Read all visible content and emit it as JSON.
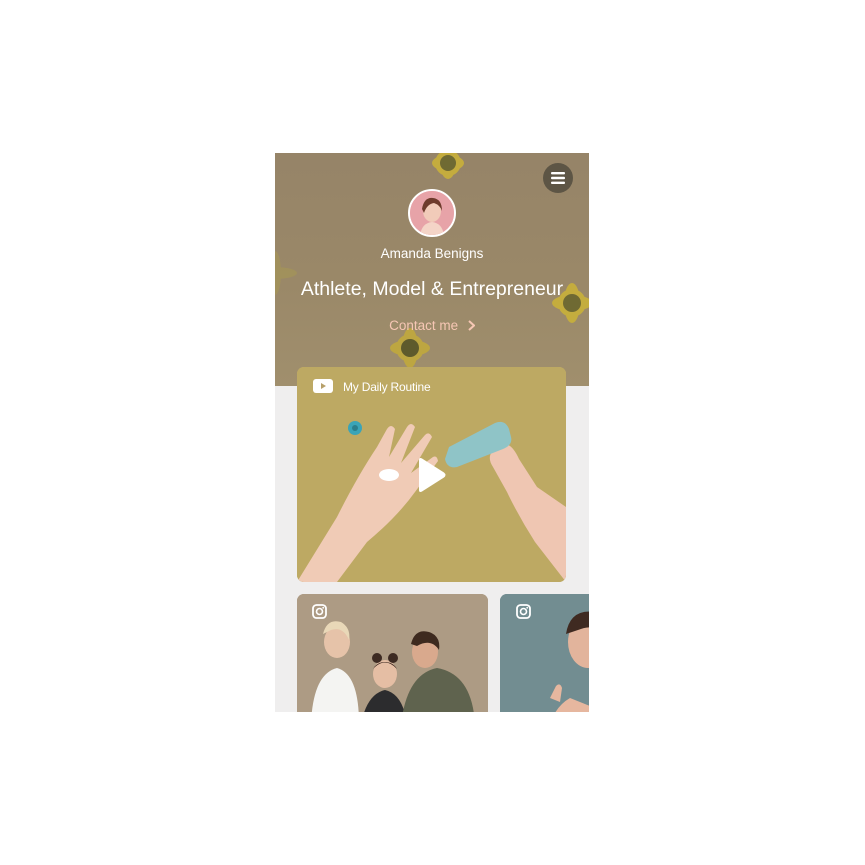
{
  "profile": {
    "name": "Amanda Benigns",
    "headline": "Athlete, Model & Entrepreneur",
    "contact_label": "Contact me"
  },
  "video": {
    "title": "My Daily Routine",
    "icon": "youtube-icon"
  },
  "instagram_posts": [
    {
      "icon": "instagram-icon"
    },
    {
      "icon": "instagram-icon"
    }
  ],
  "colors": {
    "hero_bg": "#9a8868",
    "contact_accent": "#f6c7b4",
    "page_bg": "#efeeee",
    "menu_button": "#5d5545"
  }
}
